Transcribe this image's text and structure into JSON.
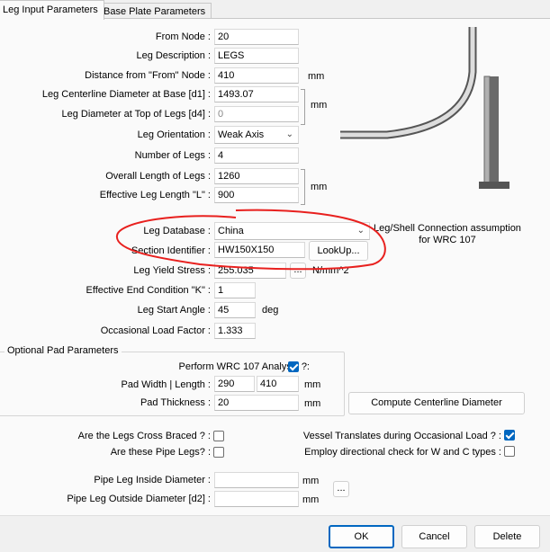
{
  "tabs": [
    {
      "label": "Leg Input Parameters",
      "active": true
    },
    {
      "label": "Base Plate Parameters",
      "active": false
    }
  ],
  "fields": {
    "from_node": {
      "label": "From Node :",
      "value": "20"
    },
    "leg_description": {
      "label": "Leg Description :",
      "value": "LEGS"
    },
    "distance_from": {
      "label": "Distance from \"From\" Node :",
      "value": "410",
      "unit": "mm"
    },
    "centerline_diameter": {
      "label": "Leg Centerline Diameter at Base [d1] :",
      "value": "1493.07"
    },
    "diameter_top": {
      "label": "Leg Diameter at Top of Legs [d4] :",
      "value": "0"
    },
    "diameter_unit": "mm",
    "orientation": {
      "label": "Leg Orientation :",
      "value": "Weak Axis"
    },
    "number_of_legs": {
      "label": "Number of Legs :",
      "value": "4"
    },
    "overall_length": {
      "label": "Overall Length of Legs :",
      "value": "1260"
    },
    "effective_length": {
      "label": "Effective Leg Length \"L\" :",
      "value": "900"
    },
    "length_unit": "mm",
    "leg_database": {
      "label": "Leg Database :",
      "value": "China"
    },
    "section_identifier": {
      "label": "Section Identifier :",
      "value": "HW150X150",
      "button": "LookUp..."
    },
    "yield_stress": {
      "label": "Leg Yield Stress :",
      "value": "255.035",
      "button": "...",
      "unit": "N/mm^2"
    },
    "end_condition": {
      "label": "Effective End Condition \"K\" :",
      "value": "1"
    },
    "start_angle": {
      "label": "Leg Start Angle :",
      "value": "45",
      "unit": "deg"
    },
    "occasional_load": {
      "label": "Occasional Load Factor :",
      "value": "1.333"
    }
  },
  "connection_note": "Leg/Shell Connection assumption for WRC 107",
  "pad_group": {
    "title": "Optional Pad Parameters",
    "wrc_label": "Perform WRC 107 Analysis ?:",
    "wrc_checked": true,
    "width_label": "Pad Width | Length :",
    "width": "290",
    "length": "410",
    "thickness_label": "Pad Thickness :",
    "thickness": "20",
    "unit": "mm"
  },
  "compute_button": "Compute Centerline Diameter",
  "checks": {
    "cross_braced": {
      "label": "Are the Legs Cross Braced ? :",
      "checked": false
    },
    "pipe_legs": {
      "label": "Are these Pipe Legs? :",
      "checked": false
    },
    "vessel_translates": {
      "label": "Vessel Translates during Occasional Load ? :",
      "checked": true
    },
    "directional_check": {
      "label": "Employ directional check for W and C types :",
      "checked": false
    }
  },
  "pipe": {
    "inside_label": "Pipe Leg Inside Diameter :",
    "inside_value": "",
    "outside_label": "Pipe Leg Outside Diameter [d2] :",
    "outside_value": "",
    "unit": "mm",
    "button": "..."
  },
  "footer": {
    "ok": "OK",
    "cancel": "Cancel",
    "delete": "Delete"
  },
  "colors": {
    "accent": "#0067c0",
    "annotation": "#e8201e",
    "panel": "#fafafa"
  }
}
